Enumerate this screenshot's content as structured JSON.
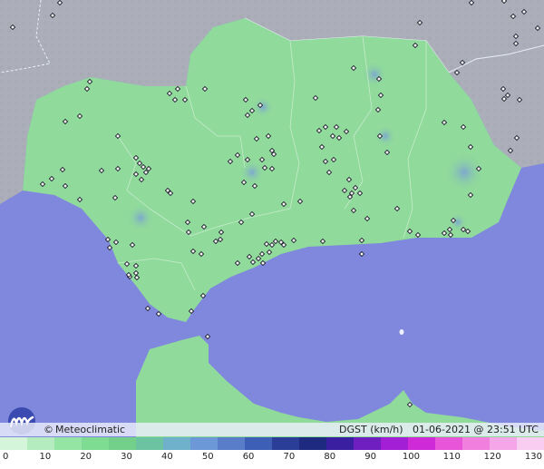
{
  "brand": {
    "copyright": "©",
    "name": "Meteoclimatic"
  },
  "info": {
    "parameter": "DGST (km/h)",
    "date": "01-06-2021",
    "at": "@",
    "time": "23:51 UTC"
  },
  "legend": {
    "ticks": [
      "0",
      "10",
      "20",
      "30",
      "40",
      "50",
      "60",
      "70",
      "80",
      "90",
      "100",
      "110",
      "120",
      "130"
    ],
    "colors": [
      "#d4f5da",
      "#b4ecbf",
      "#94e4a4",
      "#7edb92",
      "#72d08a",
      "#6cc3a2",
      "#6fb1cb",
      "#6d98d8",
      "#5a7dc9",
      "#3d5fb5",
      "#2a3e98",
      "#1d2a80",
      "#3a1fa0",
      "#6f1fc0",
      "#a31fd6",
      "#cf2ad8",
      "#e855d8",
      "#f07fde",
      "#f5a6e8",
      "#f9cdf1"
    ]
  },
  "colors": {
    "sea": "#7f88dc",
    "land_region": "#90da9b",
    "land_outside": "#a9acb8",
    "borders": "#e8edf8"
  },
  "icons": {
    "logo": "meteoclimatic-logo-icon"
  }
}
